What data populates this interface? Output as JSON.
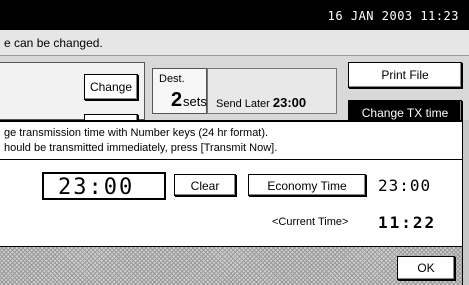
{
  "status_bar": {
    "datetime": "16 JAN 2003 11:23"
  },
  "message_line": "e can be changed.",
  "buttons": {
    "change": "Change",
    "print_file": "Print File",
    "change_tx_time": "Change TX time",
    "clear": "Clear",
    "economy_time": "Economy Time",
    "ok": "OK"
  },
  "dest": {
    "label": "Dest.",
    "count": "2",
    "unit": "sets"
  },
  "send_later": {
    "label": "Send Later",
    "time": "23:00"
  },
  "instructions": {
    "line1": "ge transmission time with Number keys (24 hr format).",
    "line2": "hould be transmitted immediately, press [Transmit Now]."
  },
  "time_entry": {
    "value": "23:00"
  },
  "economy_time_value": "23:00",
  "current_time": {
    "label": "<Current Time>",
    "value": "11:22"
  }
}
